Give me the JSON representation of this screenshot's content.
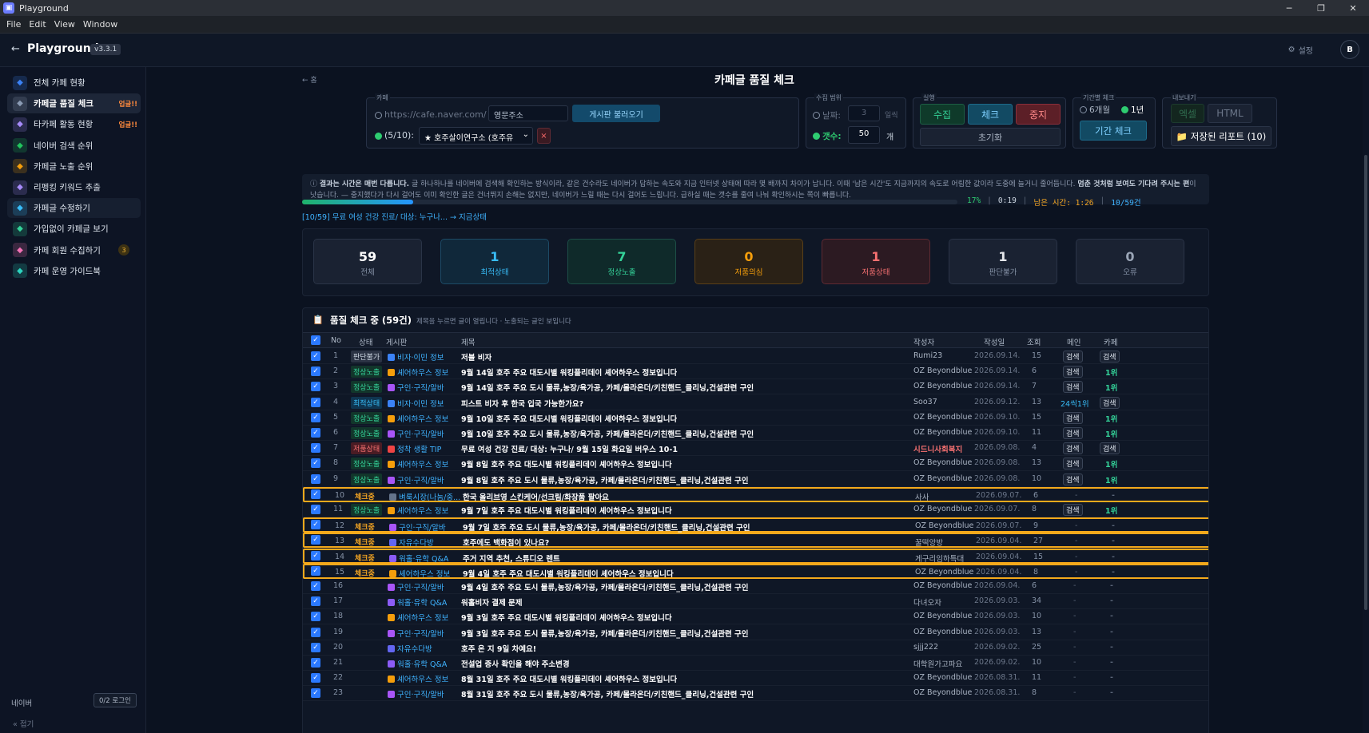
{
  "window": {
    "title": "Playground",
    "icon": "app-icon"
  },
  "menu": [
    "File",
    "Edit",
    "View",
    "Window"
  ],
  "header": {
    "app_name": "Playground",
    "version": "v3.3.1",
    "settings_label": "설정",
    "avatar": "B"
  },
  "sidebar": {
    "items": [
      {
        "label": "전체 카페 현황",
        "icon": "grid-icon",
        "color": "#3b82f6"
      },
      {
        "label": "카페글 품질 체크",
        "icon": "target-icon",
        "color": "#8b9bb4",
        "badge": "업글!!",
        "active": true
      },
      {
        "label": "타카페 활동 현황",
        "icon": "bar-chart-icon",
        "color": "#a78bfa",
        "badge": "업글!!"
      },
      {
        "label": "네이버 검색 순위",
        "icon": "search-icon",
        "color": "#22c55e"
      },
      {
        "label": "카페글 노출 순위",
        "icon": "trend-icon",
        "color": "#f59e0b"
      },
      {
        "label": "리펭킹 키워드 추출",
        "icon": "chart-icon",
        "color": "#a78bfa"
      },
      {
        "label": "카페글 수정하기",
        "icon": "edit-icon",
        "color": "#38bdf8",
        "hover": true
      },
      {
        "label": "가입없이 카페글 보기",
        "icon": "eye-icon",
        "color": "#34d399"
      },
      {
        "label": "카페 회원 수집하기",
        "icon": "users-icon",
        "color": "#f472b6",
        "count": "3"
      },
      {
        "label": "카페 운영 가이드북",
        "icon": "book-icon",
        "color": "#2dd4bf"
      }
    ],
    "footer_label": "네이버",
    "footer_button": "0/2 로그인",
    "collapse_label": "접기"
  },
  "page": {
    "title": "카페글 품질 체크",
    "home_link": "← 홈"
  },
  "controls": {
    "cafe": {
      "legend": "카페",
      "url_placeholder": "https://cafe.naver.com/",
      "name_placeholder": "영문주소",
      "load_button": "게시판 불러오기",
      "selected_count": "(5/10):",
      "selected_cafe": "★ 호주살이연구소 (호주유",
      "remove": "×"
    },
    "range": {
      "legend": "수집 범위",
      "days_label": "날짜:",
      "days_value": "3",
      "days_unit": "일씩",
      "count_label": "갯수:",
      "count_value": "50",
      "count_unit": "개"
    },
    "run": {
      "legend": "실행",
      "collect": "수집",
      "check": "체크",
      "stop": "중지",
      "reset": "초기화"
    },
    "period": {
      "legend": "기간별 체크",
      "opt1": "6개월",
      "opt2": "1년",
      "button": "기간 체크"
    },
    "export": {
      "legend": "내보내기",
      "excel": "엑셀",
      "html": "HTML",
      "saved": "📁 저장된 리포트 (10)"
    }
  },
  "info": {
    "bold": "결과는 시간은 매번 다릅니다.",
    "text": " 글 하나하나를 네이버에 검색해 확인하는 방식이라, 같은 건수라도 네이버가 답하는 속도와 지금 인터넷 상태에 따라 몇 배까지 차이가 납니다. 이때 '남은 시간'도 지금까지의 속도로 어림한 값이라 도중에 늘거니 줄어듭니다. ",
    "bold2": "멈춘 것처럼 보여도 기다려 주시는 편",
    "text2": "이 낫습니다. — 중지했다가 다시 걸어도 이미 확인한 글은 건너뛰지 손해는 없지만, 네이버가 느릴 때는 다시 걸어도 느립니다. 급하실 때는 갯수를 줄여 나눠 확인하시는 쪽이 빠릅니다."
  },
  "progress": {
    "value": 0.17,
    "percent": "17%",
    "elapsed": "0:19",
    "remaining": "남은 시간: 1:26",
    "count": "10/59건",
    "status": "[10/59] 무료 여성 건강 진료/ 대상: 누구나... → 지금상태"
  },
  "summary": [
    {
      "num": "59",
      "label": "전체",
      "color": "#ffffff",
      "bg": "#1a2232",
      "border": "#2a3447",
      "lcolor": "#8592a6"
    },
    {
      "num": "1",
      "label": "최적상태",
      "color": "#38bdf8",
      "bg": "#10283a",
      "border": "#1d4a66",
      "lcolor": "#38bdf8"
    },
    {
      "num": "7",
      "label": "정상노출",
      "color": "#34d399",
      "bg": "#0f2a2a",
      "border": "#1d4f47",
      "lcolor": "#34d399"
    },
    {
      "num": "0",
      "label": "저품의심",
      "color": "#f59e0b",
      "bg": "#2a2116",
      "border": "#5a3f17",
      "lcolor": "#f59e0b"
    },
    {
      "num": "1",
      "label": "저품상태",
      "color": "#f87171",
      "bg": "#2c1a22",
      "border": "#5e2a33",
      "lcolor": "#f87171"
    },
    {
      "num": "1",
      "label": "판단불가",
      "color": "#e5e7eb",
      "bg": "#1a2232",
      "border": "#2a3447",
      "lcolor": "#8592a6"
    },
    {
      "num": "0",
      "label": "오류",
      "color": "#9aa5b6",
      "bg": "#1a2232",
      "border": "#2a3447",
      "lcolor": "#8592a6"
    }
  ],
  "table": {
    "title": "품질 체크 중 (59건)",
    "subtitle": "제목을 누르면 글이 열립니다 · 노출되는 글인 보입니다",
    "columns": [
      "No",
      "상태",
      "게시판",
      "제목",
      "작성자",
      "작성일",
      "조회",
      "메인",
      "카페"
    ],
    "rows": [
      {
        "no": "1",
        "status": "판단불가",
        "sk": "unk",
        "board": "비자·이민 정보",
        "bc": "#3b82f6",
        "title": "저블 비자",
        "author": "Rumi23",
        "date": "2026.09.14.",
        "views": "15",
        "main": "검색",
        "cafe": "검색"
      },
      {
        "no": "2",
        "status": "정상노출",
        "sk": "ok",
        "board": "셰어하우스 정보",
        "bc": "#f59e0b",
        "title": "9월 14일 호주 주요 대도시별 워킹플리데이 셰어하우스 정보입니다",
        "author": "OZ Beyondblue",
        "date": "2026.09.14.",
        "views": "6",
        "main": "검색",
        "cafe": "1위"
      },
      {
        "no": "3",
        "status": "정상노출",
        "sk": "ok",
        "board": "구인·구직/알바",
        "bc": "#a855f7",
        "title": "9월 14일 호주 주요 도시 물류,농장/육가공, 카페/몰라온더/키친핸드_클리닝,건설관련 구인",
        "author": "OZ Beyondblue",
        "date": "2026.09.14.",
        "views": "7",
        "main": "검색",
        "cafe": "1위"
      },
      {
        "no": "4",
        "status": "최적상태",
        "sk": "best",
        "board": "비자·이민 정보",
        "bc": "#3b82f6",
        "title": "피스트 비자 후 한국 입국 가능한가요?",
        "author": "Soo37",
        "date": "2026.09.12.",
        "views": "13",
        "main": "24씩1위",
        "cafe": "검색"
      },
      {
        "no": "5",
        "status": "정상노출",
        "sk": "ok",
        "board": "셰어하우스 정보",
        "bc": "#f59e0b",
        "title": "9월 10일 호주 주요 대도시별 워킹플리데이 셰어하우스 정보입니다",
        "author": "OZ Beyondblue",
        "date": "2026.09.10.",
        "views": "15",
        "main": "검색",
        "cafe": "1위"
      },
      {
        "no": "6",
        "status": "정상노출",
        "sk": "ok",
        "board": "구인·구직/알바",
        "bc": "#a855f7",
        "title": "9월 10일 호주 주요 도시 물류,농장/육가공, 카페/몰라온더/키친핸드_클리닝,건설관련 구인",
        "author": "OZ Beyondblue",
        "date": "2026.09.10.",
        "views": "11",
        "main": "검색",
        "cafe": "1위"
      },
      {
        "no": "7",
        "status": "저품상태",
        "sk": "bad",
        "board": "정착 생활 TIP",
        "bc": "#ef4444",
        "title": "무료 여성 건강 진료/ 대상: 누구나/ 9월 15일 화요일 버우스 10-1",
        "author": "시드니사회복지",
        "date": "2026.09.08.",
        "views": "4",
        "main": "검색",
        "cafe": "검색",
        "ared": true
      },
      {
        "no": "8",
        "status": "정상노출",
        "sk": "ok",
        "board": "셰어하우스 정보",
        "bc": "#f59e0b",
        "title": "9월 8일 호주 주요 대도시별 워킹플리데이 셰어하우스 정보입니다",
        "author": "OZ Beyondblue",
        "date": "2026.09.08.",
        "views": "13",
        "main": "검색",
        "cafe": "1위"
      },
      {
        "no": "9",
        "status": "정상노출",
        "sk": "ok",
        "board": "구인·구직/알바",
        "bc": "#a855f7",
        "title": "9월 8일 호주 주요 도시 물류,농장/육가공, 카페/몰라온더/키친핸드_클리닝,건설관련 구인",
        "author": "OZ Beyondblue",
        "date": "2026.09.08.",
        "views": "10",
        "main": "검색",
        "cafe": "1위"
      },
      {
        "no": "10",
        "status": "체크중",
        "sk": "chk",
        "board": "벼룩시장(나눔/중...",
        "bc": "#64748b",
        "title": "한국 올리브영 스킨케어/선크림/화장품 팔아요",
        "author": "사사",
        "date": "2026.09.07.",
        "views": "6",
        "main": "-",
        "cafe": "-",
        "hl": true
      },
      {
        "no": "11",
        "status": "정상노출",
        "sk": "ok",
        "board": "셰어하우스 정보",
        "bc": "#f59e0b",
        "title": "9월 7일 호주 주요 대도시별 워킹플리데이 셰어하우스 정보입니다",
        "author": "OZ Beyondblue",
        "date": "2026.09.07.",
        "views": "8",
        "main": "검색",
        "cafe": "1위"
      },
      {
        "no": "12",
        "status": "체크중",
        "sk": "chk",
        "board": "구인·구직/알바",
        "bc": "#a855f7",
        "title": "9월 7일 호주 주요 도시 물류,농장/육가공, 카페/몰라온더/키친핸드_클리닝,건설관련 구인",
        "author": "OZ Beyondblue",
        "date": "2026.09.07.",
        "views": "9",
        "main": "-",
        "cafe": "-",
        "hl": true
      },
      {
        "no": "13",
        "status": "체크중",
        "sk": "chk",
        "board": "자유수다방",
        "bc": "#6366f1",
        "title": "호주에도 백화점이 있나요?",
        "author": "꿀떡앙방",
        "date": "2026.09.04.",
        "views": "27",
        "main": "-",
        "cafe": "-",
        "hl": true
      },
      {
        "no": "14",
        "status": "체크중",
        "sk": "chk",
        "board": "워홀·유학 Q&A",
        "bc": "#8b5cf6",
        "title": "주거 지역 추천, 스튜디오 렌트",
        "author": "게구리임하특대",
        "date": "2026.09.04.",
        "views": "15",
        "main": "-",
        "cafe": "-",
        "hl": true
      },
      {
        "no": "15",
        "status": "체크중",
        "sk": "chk",
        "board": "셰어하우스 정보",
        "bc": "#f59e0b",
        "title": "9월 4일 호주 주요 대도시별 워킹플리데이 셰어하우스 정보입니다",
        "author": "OZ Beyondblue",
        "date": "2026.09.04.",
        "views": "8",
        "main": "-",
        "cafe": "-",
        "hl": true
      },
      {
        "no": "16",
        "status": "",
        "sk": "none",
        "board": "구인·구직/알바",
        "bc": "#a855f7",
        "title": "9월 4일 호주 주요 도시 물류,농장/육가공, 카페/몰라온더/키친핸드_클리닝,건설관련 구인",
        "author": "OZ Beyondblue",
        "date": "2026.09.04.",
        "views": "6",
        "main": "-",
        "cafe": "-"
      },
      {
        "no": "17",
        "status": "",
        "sk": "none",
        "board": "워홀·유학 Q&A",
        "bc": "#8b5cf6",
        "title": "워홀비자 결제 문제",
        "author": "다녀오자",
        "date": "2026.09.03.",
        "views": "34",
        "main": "-",
        "cafe": "-"
      },
      {
        "no": "18",
        "status": "",
        "sk": "none",
        "board": "셰어하우스 정보",
        "bc": "#f59e0b",
        "title": "9월 3일 호주 주요 대도시별 워킹플리데이 셰어하우스 정보입니다",
        "author": "OZ Beyondblue",
        "date": "2026.09.03.",
        "views": "10",
        "main": "-",
        "cafe": "-"
      },
      {
        "no": "19",
        "status": "",
        "sk": "none",
        "board": "구인·구직/알바",
        "bc": "#a855f7",
        "title": "9월 3일 호주 주요 도시 물류,농장/육가공, 카페/몰라온더/키친핸드_클리닝,건설관련 구인",
        "author": "OZ Beyondblue",
        "date": "2026.09.03.",
        "views": "13",
        "main": "-",
        "cafe": "-"
      },
      {
        "no": "20",
        "status": "",
        "sk": "none",
        "board": "자유수다방",
        "bc": "#6366f1",
        "title": "호주 온 지 9일 차예요!",
        "author": "sjjj222",
        "date": "2026.09.02.",
        "views": "25",
        "main": "-",
        "cafe": "-"
      },
      {
        "no": "21",
        "status": "",
        "sk": "none",
        "board": "워홀·유학 Q&A",
        "bc": "#8b5cf6",
        "title": "전설업 증사 확인을 해야 주소변경",
        "author": "대학원가고파요",
        "date": "2026.09.02.",
        "views": "10",
        "main": "-",
        "cafe": "-"
      },
      {
        "no": "22",
        "status": "",
        "sk": "none",
        "board": "셰어하우스 정보",
        "bc": "#f59e0b",
        "title": "8월 31일 호주 주요 대도시별 워킹플리데이 셰어하우스 정보입니다",
        "author": "OZ Beyondblue",
        "date": "2026.08.31.",
        "views": "11",
        "main": "-",
        "cafe": "-"
      },
      {
        "no": "23",
        "status": "",
        "sk": "none",
        "board": "구인·구직/알바",
        "bc": "#a855f7",
        "title": "8월 31일 호주 주요 도시 물류,농장/육가공, 카페/몰라온더/키친핸드_클리닝,건설관련 구인",
        "author": "OZ Beyondblue",
        "date": "2026.08.31.",
        "views": "8",
        "main": "-",
        "cafe": "-"
      }
    ]
  }
}
